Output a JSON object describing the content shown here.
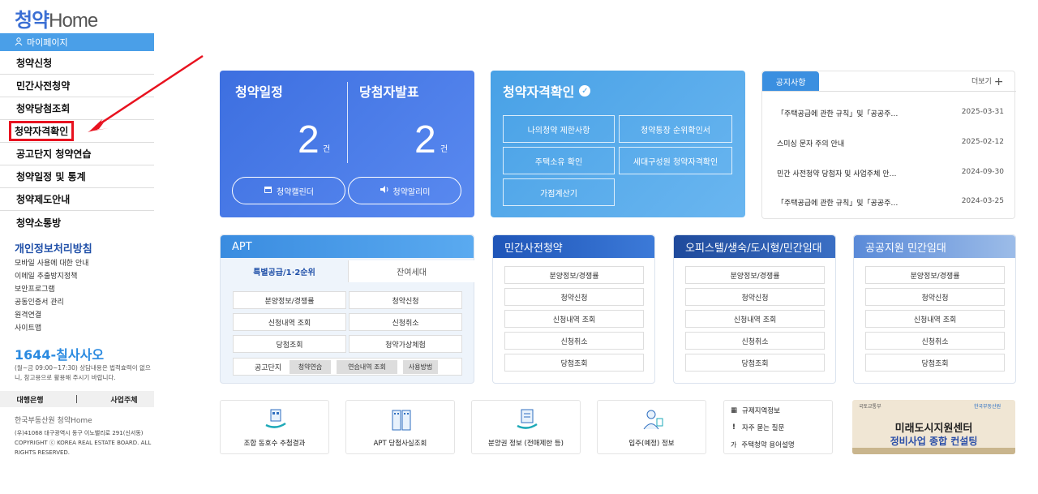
{
  "logo": {
    "text_a": "청약",
    "text_b": "Home"
  },
  "sidebar": {
    "mypage": "마이페이지",
    "items": [
      "청약신청",
      "민간사전청약",
      "청약당첨조회",
      "청약자격확인",
      "공고단지 청약연습",
      "청약일정 및 통계",
      "청약제도안내",
      "청약소통방"
    ],
    "privacy": "개인정보처리방침",
    "links": [
      "모바일 사용에 대한 안내",
      "이메일 추출방지정책",
      "보안프로그램",
      "공동인증서 관리",
      "원격연결",
      "사이트맵"
    ],
    "phone": "1644-칠사사오",
    "phone_note": "(월~금 09:00~17:30) 상담내용은 법적효력이 없으니, 참고용으로 활용해 주시기 바랍니다.",
    "bank": "대행은행",
    "owner": "사업주체",
    "org": "한국부동산원 청약Home",
    "address": "(우)41068 대구광역시 동구 이노밸리로 291(신서동)",
    "copyright": "COPYRIGHT ⓒ KOREA REAL ESTATE BOARD. ALL RIGHTS RESERVED."
  },
  "schedule_card": {
    "title1": "청약일정",
    "count1": "2",
    "unit1": "건",
    "title2": "당첨자발표",
    "count2": "2",
    "unit2": "건",
    "btn_calendar": "청약캘린더",
    "btn_alarm": "청약알리미"
  },
  "qualify_card": {
    "title": "청약자격확인",
    "buttons": [
      "나의청약 제한사항",
      "청약통장 순위확인서",
      "주택소유 확인",
      "세대구성원 청약자격확인",
      "가점계산기"
    ]
  },
  "notice": {
    "tab": "공지사항",
    "more": "더보기",
    "rows": [
      {
        "title": "「주택공급에 관한 규칙」및「공공주…",
        "date": "2025-03-31"
      },
      {
        "title": "스미싱 문자 주의 안내",
        "date": "2025-02-12"
      },
      {
        "title": "민간 사전청약 당첨자 및 사업주체 안…",
        "date": "2024-09-30"
      },
      {
        "title": "「주택공급에 관한 규칙」및「공공주…",
        "date": "2024-03-25"
      }
    ]
  },
  "apt": {
    "title": "APT",
    "tab_active": "특별공급/1·2순위",
    "tab_other": "잔여세대",
    "buttons": [
      "분양정보/경쟁률",
      "청약신청",
      "신청내역 조회",
      "신청취소",
      "당첨조회",
      "청약가상체험"
    ],
    "practice_label": "공고단지",
    "chips": [
      "청약연습",
      "연습내역 조회",
      "사용방법"
    ]
  },
  "sections": [
    {
      "title": "민간사전청약",
      "buttons": [
        "분양정보/경쟁률",
        "청약신청",
        "신청내역 조회",
        "신청취소",
        "당첨조회"
      ]
    },
    {
      "title": "오피스텔/생숙/도시형/민간임대",
      "buttons": [
        "분양정보/경쟁률",
        "청약신청",
        "신청내역 조회",
        "신청취소",
        "당첨조회"
      ]
    },
    {
      "title": "공공지원 민간임대",
      "buttons": [
        "분양정보/경쟁률",
        "청약신청",
        "신청내역 조회",
        "신청취소",
        "당첨조회"
      ]
    }
  ],
  "quick": [
    "조합 동호수 추첨결과",
    "APT 당첨사실조회",
    "분양권 정보 (전매제한 등)",
    "입주(예정) 정보"
  ],
  "links": [
    "규제지역정보",
    "자주 묻는 질문",
    "주택청약 용어설명"
  ],
  "banner": {
    "line1": "미래도시지원센터",
    "line2": "정비사업 종합 컨설팅",
    "org": "국토교통부",
    "org2": "한국부동산원"
  },
  "colors": {
    "primary": "#3d6fe0",
    "sky": "#48a1e6",
    "highlight": "#e8121f"
  }
}
